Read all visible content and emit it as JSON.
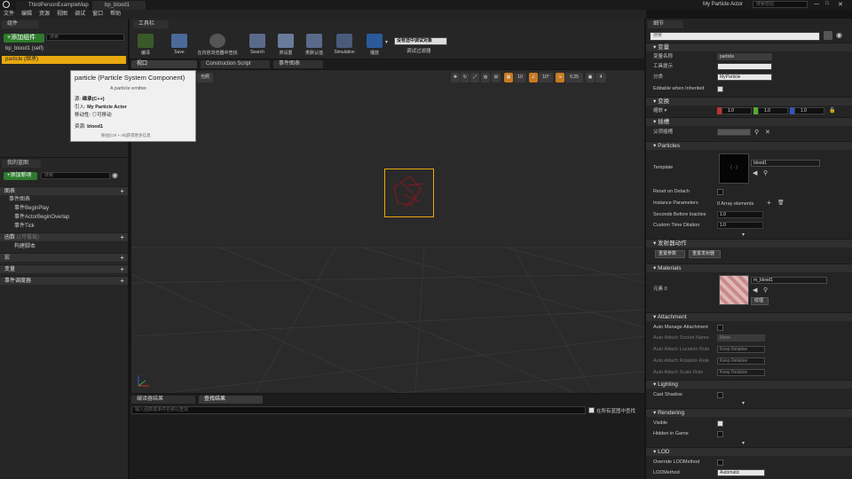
{
  "window": {
    "tabs": [
      "ThirdPersonExampleMap",
      "bp_blood1"
    ],
    "actor_name": "My Particle Actor",
    "search_placeholder": "搜索帮助"
  },
  "menu": [
    "文件",
    "编辑",
    "资源",
    "视图",
    "调试",
    "窗口",
    "帮助"
  ],
  "components_panel": {
    "title": "组件",
    "add_button": "+添加组件",
    "search_placeholder": "搜索",
    "self_item": "bp_blood1 (self)",
    "child_item": "particle (继承)"
  },
  "tooltip": {
    "title": "particle (Particle System Component)",
    "subtitle": "A particle emitter.",
    "source_label": "源:",
    "source_value": "继承(C++)",
    "introduced_label": "引入:",
    "introduced_value": "My Particle Actor",
    "mobility_label": "移动性:",
    "mobility_value": "可移动",
    "asset_label": "资源:",
    "asset_value": "blood1",
    "hint": "按住[Ctrl + Alt]获得更多信息"
  },
  "my_blueprint": {
    "title": "我的蓝图",
    "add_button": "+添加新项",
    "search_placeholder": "搜索",
    "sections": {
      "graphs": "图表",
      "event_graph": "事件图表",
      "events": [
        "事件BeginPlay",
        "事件ActorBeginOverlap",
        "事件Tick"
      ],
      "functions": "函数",
      "functions_count": "(1可覆载)",
      "construction": "构建脚本",
      "macros": "宏",
      "variables": "变量",
      "dispatchers": "事件调度器"
    }
  },
  "toolbar": {
    "title": "工具栏",
    "buttons": [
      "编译",
      "Save",
      "在内容浏览器中查找",
      "Search",
      "类设置",
      "类默认值",
      "Simulation",
      "播放"
    ],
    "debug_dropdown": "没有选中调试对象",
    "debug_label": "调试过滤器"
  },
  "editor_tabs": [
    "视口",
    "Construction Script",
    "事件图表"
  ],
  "viewport": {
    "perspective_label": "光照",
    "grid_value": "10",
    "angle_value": "10°",
    "scale_value": "0.25",
    "camera_speed": "4"
  },
  "bottom_panel": {
    "tabs": [
      "编译器结果",
      "查找结果"
    ],
    "search_placeholder": "输入函数或事件名称以查找",
    "find_all_label": "在所有蓝图中查找"
  },
  "details": {
    "title": "细节",
    "search_placeholder": "搜索",
    "variable": {
      "category": "变量",
      "name_label": "变量名称",
      "name_value": "particle",
      "tooltip_label": "工具提示",
      "category_label": "分类",
      "category_value": "MyParticle",
      "editable_label": "Editable when Inherited"
    },
    "transform": {
      "category": "变换",
      "scale_label": "缩放",
      "x": "1.0",
      "y": "1.0",
      "z": "1.0"
    },
    "sockets": {
      "category": "插槽",
      "parent_label": "父项插槽"
    },
    "particles": {
      "category": "Particles",
      "template_label": "Template",
      "template_value": "blood1",
      "reset_label": "Reset on Detach",
      "instance_label": "Instance Parameters",
      "instance_value": "0 Array elements",
      "seconds_label": "Seconds Before Inactive",
      "seconds_value": "1.0",
      "dilation_label": "Custom Time Dilation",
      "dilation_value": "1.0"
    },
    "emitter": {
      "category": "发射器动作",
      "reset_button": "重置参数",
      "reset_emitters_button": "重置发射器"
    },
    "materials": {
      "category": "Materials",
      "element_label": "元素 0",
      "material_value": "m_blood1",
      "textures_button": "纹理"
    },
    "attachment": {
      "category": "Attachment",
      "auto_manage": "Auto Manage Attachment",
      "socket_label": "Auto Attach Socket Name",
      "socket_value": "None",
      "loc_label": "Auto Attach Location Rule",
      "rot_label": "Auto Attach Rotation Rule",
      "scale_label": "Auto Attach Scale Rule",
      "rule_value": "Keep Relative"
    },
    "lighting": {
      "category": "Lighting",
      "cast_shadow": "Cast Shadow"
    },
    "rendering": {
      "category": "Rendering",
      "visible": "Visible",
      "hidden": "Hidden in Game"
    },
    "lod": {
      "category": "LOD",
      "override": "Override LODMethod",
      "method_label": "LODMethod",
      "method_value": "Automatic"
    }
  }
}
